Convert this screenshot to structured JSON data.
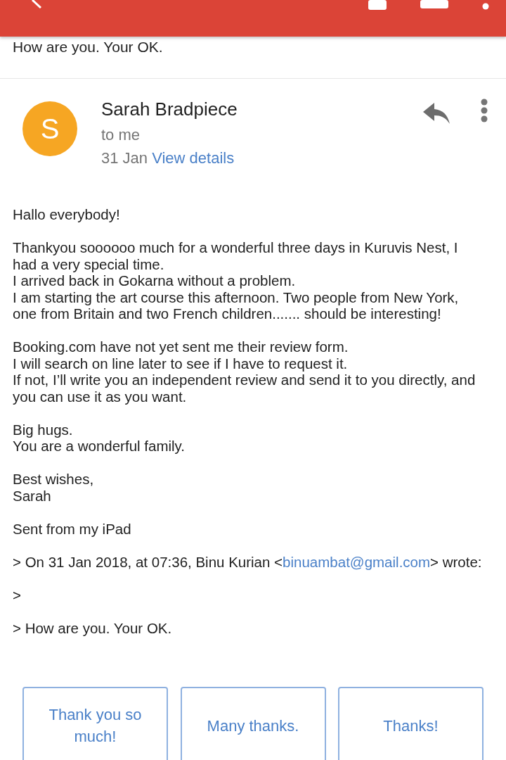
{
  "quoted_preview": "How are you. Your OK.",
  "message": {
    "avatar_letter": "S",
    "sender": "Sarah Bradpiece",
    "recipient": "to me",
    "date": "31 Jan",
    "details_link": "View details"
  },
  "body": [
    [
      "Hallo everybody!"
    ],
    [
      "Thankyou soooooo much for a wonderful three days in Kuruvis Nest, I",
      "had a very special time.",
      "I arrived back in Gokarna without a problem.",
      "I am starting the art course this afternoon. Two people from New York,",
      "one from Britain and two French children....... should be interesting!"
    ],
    [
      "Booking.com have not yet sent me their review form.",
      "I will search on line later to see if I have to request it.",
      "If not, I’ll write you an independent review and send it to you directly, and",
      "you can use it as you want."
    ],
    [
      "Big hugs.",
      "You are a wonderful family."
    ],
    [
      "Best wishes,",
      "Sarah"
    ],
    [
      "Sent from my iPad"
    ]
  ],
  "quote": {
    "before": "> On 31 Jan 2018, at 07:36, Binu Kurian <",
    "email": "binuambat@gmail.com",
    "after": "> wrote:",
    "lines": [
      ">",
      "> How are you. Your OK."
    ]
  },
  "smart_replies": [
    "Thank you so much!",
    "Many thanks.",
    "Thanks!"
  ]
}
